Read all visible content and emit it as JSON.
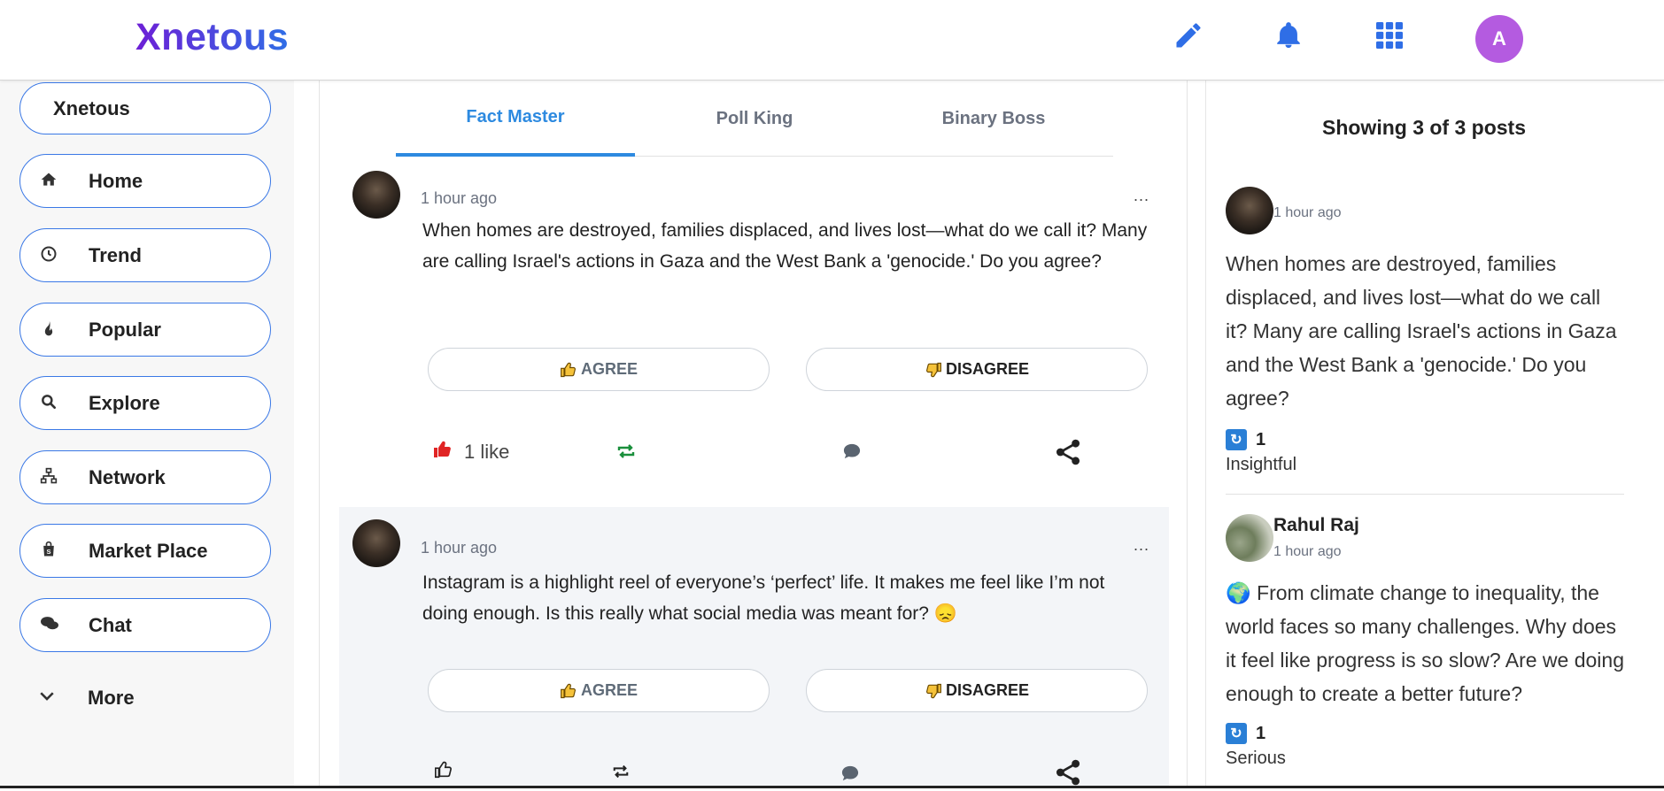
{
  "header": {
    "logo": "Xnetous",
    "avatar_initial": "A",
    "icons": [
      "pencil-icon",
      "bell-icon",
      "apps-grid-icon"
    ]
  },
  "sidebar": {
    "top_label": "Xnetous",
    "items": [
      {
        "label": "Home",
        "icon": "home-icon"
      },
      {
        "label": "Trend",
        "icon": "clock-icon"
      },
      {
        "label": "Popular",
        "icon": "fire-icon"
      },
      {
        "label": "Explore",
        "icon": "search-icon"
      },
      {
        "label": "Network",
        "icon": "network-icon"
      },
      {
        "label": "Market Place",
        "icon": "shopping-bag-icon"
      },
      {
        "label": "Chat",
        "icon": "chat-icon"
      }
    ],
    "more_label": "More"
  },
  "feed": {
    "tabs": [
      {
        "label": "Fact Master",
        "active": true
      },
      {
        "label": "Poll King",
        "active": false
      },
      {
        "label": "Binary Boss",
        "active": false
      }
    ],
    "posts": [
      {
        "time": "1 hour ago",
        "dots": "...",
        "text": "When homes are destroyed, families displaced, and lives lost—what do we call it? Many are calling Israel's actions in Gaza and the West Bank a 'genocide.' Do you agree?",
        "agree_label": "AGREE",
        "disagree_label": "DISAGREE",
        "like_count": "1 like",
        "liked": true
      },
      {
        "time": "1 hour ago",
        "dots": "...",
        "text": "Instagram is a highlight reel of everyone’s ‘perfect’ life. It makes me feel like I’m not doing enough. Is this really what social media was meant for? 😞",
        "agree_label": "AGREE",
        "disagree_label": "DISAGREE",
        "like_count": "",
        "liked": false
      }
    ]
  },
  "right_panel": {
    "title": "Showing 3 of 3 posts",
    "items": [
      {
        "name": "",
        "time": "1 hour ago",
        "text": "When homes are destroyed, families displaced, and lives lost—what do we call it? Many are calling Israel's actions in Gaza and the West Bank a 'genocide.' Do you agree?",
        "reaction_count": "1",
        "reaction_label": "Insightful"
      },
      {
        "name": "Rahul Raj",
        "time": "1 hour ago",
        "text": "🌍 From climate change to inequality, the world faces so many challenges. Why does it feel like progress is so slow? Are we doing enough to create a better future?",
        "reaction_count": "1",
        "reaction_label": "Serious"
      }
    ]
  },
  "colors": {
    "accent": "#2d8ae0",
    "nav_border": "#3a78e6",
    "avatar_bg": "#b45be0",
    "like_red": "#e02424",
    "repost_green": "#1a8f3c"
  }
}
